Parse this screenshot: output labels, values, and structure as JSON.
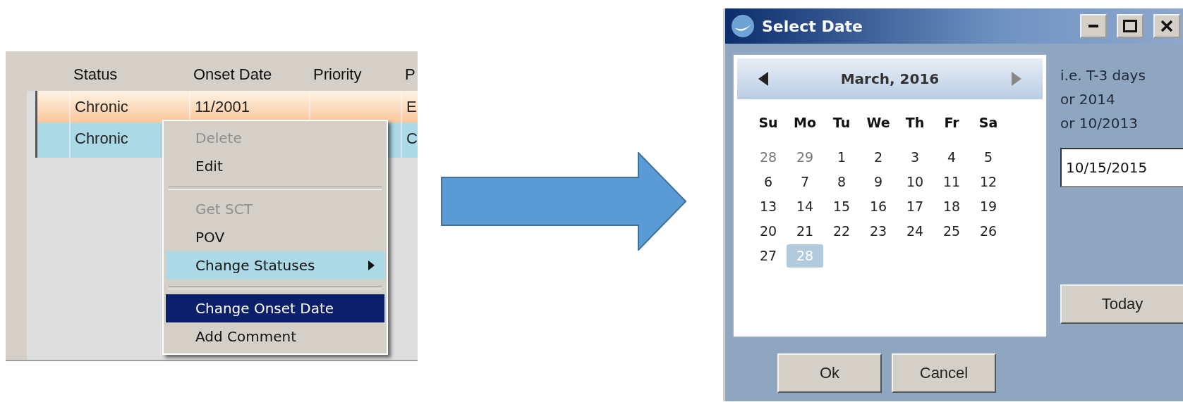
{
  "grid": {
    "columns": [
      {
        "label": "Status"
      },
      {
        "label": "Onset Date"
      },
      {
        "label": "Priority"
      },
      {
        "label": "P"
      }
    ],
    "rows": [
      {
        "cells": [
          "Chronic",
          "11/2001",
          "",
          "E"
        ],
        "selected": true
      },
      {
        "cells": [
          "Chronic",
          "",
          "",
          "C"
        ],
        "selected": false
      }
    ]
  },
  "context_menu": {
    "items": [
      {
        "kind": "item",
        "label": "Delete",
        "disabled": true,
        "highlighted": false,
        "selected": false,
        "submenu": false
      },
      {
        "kind": "item",
        "label": "Edit",
        "disabled": false,
        "highlighted": false,
        "selected": false,
        "submenu": false
      },
      {
        "kind": "separator"
      },
      {
        "kind": "item",
        "label": "Get SCT",
        "disabled": true,
        "highlighted": false,
        "selected": false,
        "submenu": false
      },
      {
        "kind": "item",
        "label": "POV",
        "disabled": false,
        "highlighted": false,
        "selected": false,
        "submenu": false
      },
      {
        "kind": "item",
        "label": "Change Statuses",
        "disabled": false,
        "highlighted": true,
        "selected": false,
        "submenu": true
      },
      {
        "kind": "separator"
      },
      {
        "kind": "item",
        "label": "Change Onset Date",
        "disabled": false,
        "highlighted": false,
        "selected": true,
        "submenu": false
      },
      {
        "kind": "item",
        "label": "Add Comment",
        "disabled": false,
        "highlighted": false,
        "selected": false,
        "submenu": false
      }
    ]
  },
  "dialog": {
    "title": "Select Date",
    "calendar": {
      "month": "March, 2016",
      "weekdays": [
        "Su",
        "Mo",
        "Tu",
        "We",
        "Th",
        "Fr",
        "Sa"
      ],
      "weeks": [
        [
          {
            "label": "28",
            "muted": true,
            "selected": false
          },
          {
            "label": "29",
            "muted": true,
            "selected": false
          },
          {
            "label": "1",
            "muted": false,
            "selected": false
          },
          {
            "label": "2",
            "muted": false,
            "selected": false
          },
          {
            "label": "3",
            "muted": false,
            "selected": false
          },
          {
            "label": "4",
            "muted": false,
            "selected": false
          },
          {
            "label": "5",
            "muted": false,
            "selected": false
          }
        ],
        [
          {
            "label": "6",
            "muted": false,
            "selected": false
          },
          {
            "label": "7",
            "muted": false,
            "selected": false
          },
          {
            "label": "8",
            "muted": false,
            "selected": false
          },
          {
            "label": "9",
            "muted": false,
            "selected": false
          },
          {
            "label": "10",
            "muted": false,
            "selected": false
          },
          {
            "label": "11",
            "muted": false,
            "selected": false
          },
          {
            "label": "12",
            "muted": false,
            "selected": false
          }
        ],
        [
          {
            "label": "13",
            "muted": false,
            "selected": false
          },
          {
            "label": "14",
            "muted": false,
            "selected": false
          },
          {
            "label": "15",
            "muted": false,
            "selected": false
          },
          {
            "label": "16",
            "muted": false,
            "selected": false
          },
          {
            "label": "17",
            "muted": false,
            "selected": false
          },
          {
            "label": "18",
            "muted": false,
            "selected": false
          },
          {
            "label": "19",
            "muted": false,
            "selected": false
          }
        ],
        [
          {
            "label": "20",
            "muted": false,
            "selected": false
          },
          {
            "label": "21",
            "muted": false,
            "selected": false
          },
          {
            "label": "22",
            "muted": false,
            "selected": false
          },
          {
            "label": "23",
            "muted": false,
            "selected": false
          },
          {
            "label": "24",
            "muted": false,
            "selected": false
          },
          {
            "label": "25",
            "muted": false,
            "selected": false
          },
          {
            "label": "26",
            "muted": false,
            "selected": false
          }
        ],
        [
          {
            "label": "27",
            "muted": false,
            "selected": false
          },
          {
            "label": "28",
            "muted": false,
            "selected": true
          }
        ]
      ]
    },
    "hint_lines": [
      "i.e. T-3 days",
      "or 2014",
      "or 10/2013"
    ],
    "date_input": {
      "value": "10/15/2015"
    },
    "today_button": "Today",
    "buttons": [
      "Ok",
      "Cancel"
    ]
  }
}
